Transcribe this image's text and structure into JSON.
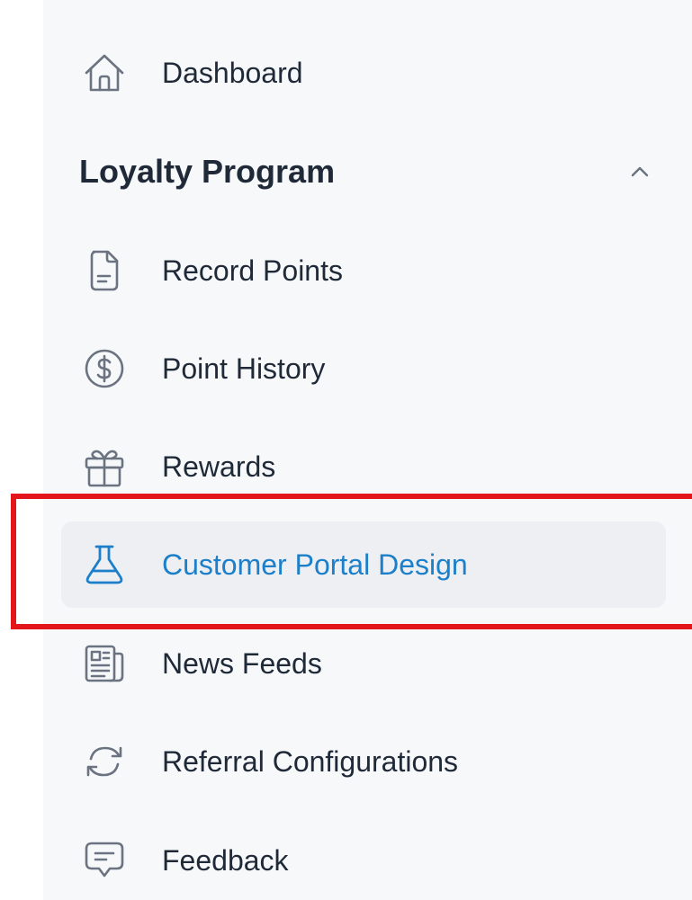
{
  "sidebar": {
    "dashboard": {
      "label": "Dashboard",
      "icon": "home-icon"
    },
    "section": {
      "title": "Loyalty Program",
      "icon": "chevron-up-icon"
    },
    "items": [
      {
        "label": "Record Points",
        "icon": "document-icon"
      },
      {
        "label": "Point History",
        "icon": "dollar-circle-icon"
      },
      {
        "label": "Rewards",
        "icon": "gift-icon"
      },
      {
        "label": "Customer Portal Design",
        "icon": "flask-icon",
        "active": true
      },
      {
        "label": "News Feeds",
        "icon": "newspaper-icon"
      },
      {
        "label": "Referral Configurations",
        "icon": "refresh-icon"
      },
      {
        "label": "Feedback",
        "icon": "chat-bubble-icon"
      }
    ]
  },
  "colors": {
    "sidebar_bg": "#f6f8fa",
    "text": "#1f2937",
    "icon": "#6b7280",
    "active_text": "#1c7fc9",
    "active_bg": "#eeeff3",
    "highlight": "#e3161b"
  }
}
